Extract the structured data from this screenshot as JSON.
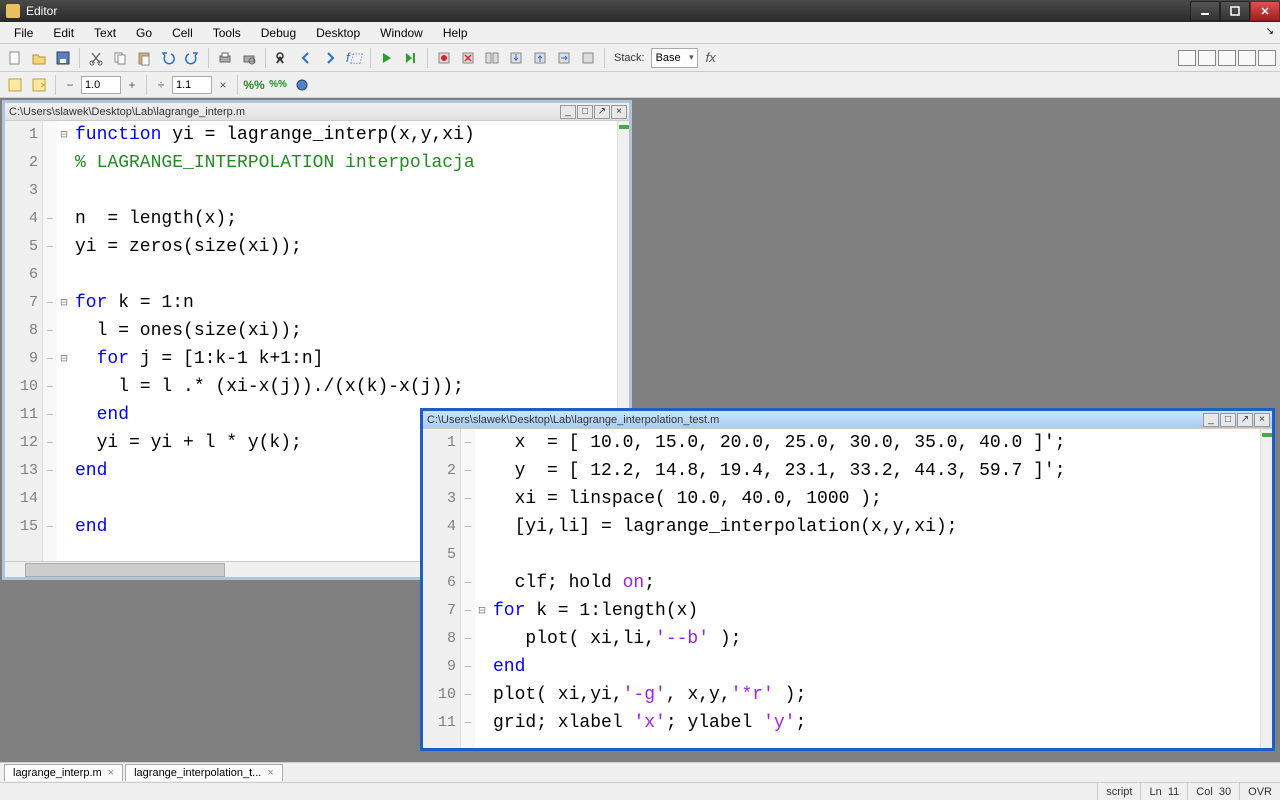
{
  "window": {
    "title": "Editor"
  },
  "menu": [
    "File",
    "Edit",
    "Text",
    "Go",
    "Cell",
    "Tools",
    "Debug",
    "Desktop",
    "Window",
    "Help"
  ],
  "toolbar": {
    "stack_label": "Stack:",
    "stack_value": "Base",
    "fx": "fx"
  },
  "toolbar2": {
    "val1": "1.0",
    "val2": "1.1"
  },
  "child1": {
    "path": "C:\\Users\\slawek\\Desktop\\Lab\\lagrange_interp.m",
    "lines": [
      {
        "n": "1",
        "bp": "",
        "fold": "⊟",
        "html": "<span class='kw'>function</span> yi = lagrange_interp(x,y,xi)"
      },
      {
        "n": "2",
        "bp": "",
        "fold": "",
        "html": "<span class='com'>% LAGRANGE_INTERPOLATION interpolacja</span>"
      },
      {
        "n": "3",
        "bp": "",
        "fold": "",
        "html": ""
      },
      {
        "n": "4",
        "bp": "–",
        "fold": "",
        "html": "n  = length(x);"
      },
      {
        "n": "5",
        "bp": "–",
        "fold": "",
        "html": "yi = zeros(size(xi));"
      },
      {
        "n": "6",
        "bp": "",
        "fold": "",
        "html": ""
      },
      {
        "n": "7",
        "bp": "–",
        "fold": "⊟",
        "html": "<span class='kw'>for</span> k = 1:n"
      },
      {
        "n": "8",
        "bp": "–",
        "fold": "",
        "html": "  l = ones(size(xi));"
      },
      {
        "n": "9",
        "bp": "–",
        "fold": "⊟",
        "html": "  <span class='kw'>for</span> j = [1:k-1 k+1:n]"
      },
      {
        "n": "10",
        "bp": "–",
        "fold": "",
        "html": "    l = l .* (xi-x(j))./(x(k)-x(j));"
      },
      {
        "n": "11",
        "bp": "–",
        "fold": "",
        "html": "  <span class='kw'>end</span>"
      },
      {
        "n": "12",
        "bp": "–",
        "fold": "",
        "html": "  yi = yi + l * y(k);"
      },
      {
        "n": "13",
        "bp": "–",
        "fold": "",
        "html": "<span class='kw'>end</span>"
      },
      {
        "n": "14",
        "bp": "",
        "fold": "",
        "html": ""
      },
      {
        "n": "15",
        "bp": "–",
        "fold": "",
        "html": "<span class='kw'>end</span>"
      }
    ]
  },
  "child2": {
    "path": "C:\\Users\\slawek\\Desktop\\Lab\\lagrange_interpolation_test.m",
    "lines": [
      {
        "n": "1",
        "bp": "–",
        "fold": "",
        "html": "  x  = [ 10.0, 15.0, 20.0, 25.0, 30.0, 35.0, 40.0 ]';"
      },
      {
        "n": "2",
        "bp": "–",
        "fold": "",
        "html": "  y  = [ 12.2, 14.8, 19.4, 23.1, 33.2, 44.3, 59.7 ]';"
      },
      {
        "n": "3",
        "bp": "–",
        "fold": "",
        "html": "  xi = linspace( 10.0, 40.0, 1000 );"
      },
      {
        "n": "4",
        "bp": "–",
        "fold": "",
        "html": "  [yi,li] = lagrange_interpolation(x,y,xi);"
      },
      {
        "n": "5",
        "bp": "",
        "fold": "",
        "html": ""
      },
      {
        "n": "6",
        "bp": "–",
        "fold": "",
        "html": "  clf; hold <span class='str'>on</span>;"
      },
      {
        "n": "7",
        "bp": "–",
        "fold": "⊟",
        "html": "<span class='kw'>for</span> k = 1:length(x)"
      },
      {
        "n": "8",
        "bp": "–",
        "fold": "",
        "html": "   plot( xi,li,<span class='str'>'--b'</span> );"
      },
      {
        "n": "9",
        "bp": "–",
        "fold": "",
        "html": "<span class='kw'>end</span>"
      },
      {
        "n": "10",
        "bp": "–",
        "fold": "",
        "html": "plot( xi,yi,<span class='str'>'-g'</span>, x,y,<span class='str'>'*r'</span> );"
      },
      {
        "n": "11",
        "bp": "–",
        "fold": "",
        "html": "grid; xlabel <span class='str'>'x'</span>; ylabel <span class='str'>'y'</span>;"
      }
    ]
  },
  "tabs": [
    {
      "label": "lagrange_interp.m"
    },
    {
      "label": "lagrange_interpolation_t..."
    }
  ],
  "status": {
    "type": "script",
    "ln_label": "Ln",
    "ln": "11",
    "col_label": "Col",
    "col": "30",
    "ovr": "OVR"
  }
}
